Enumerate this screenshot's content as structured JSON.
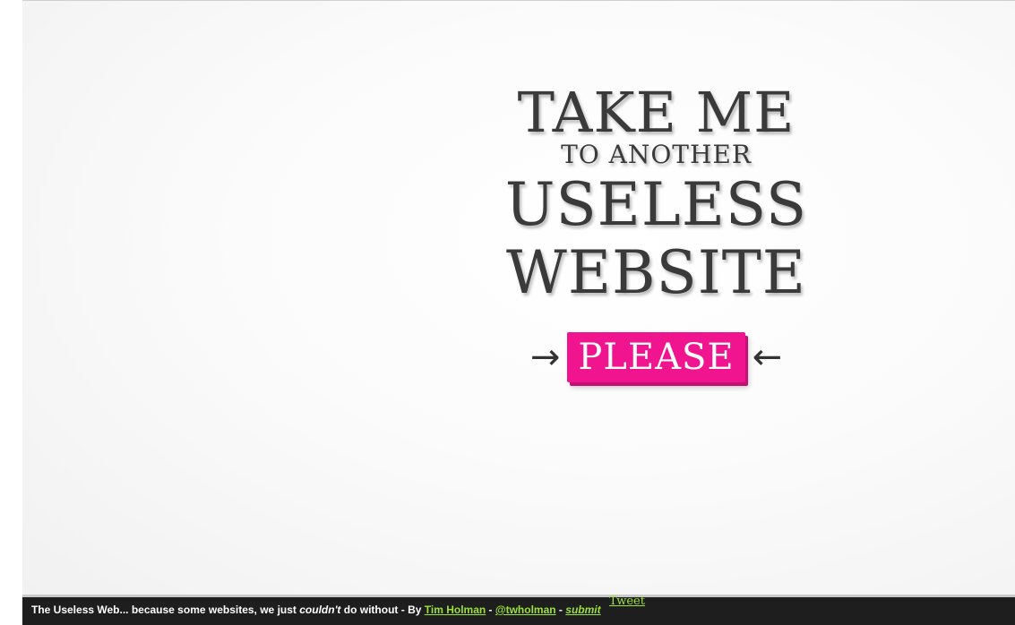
{
  "headline": {
    "line1": "TAKE ME",
    "line2": "TO ANOTHER",
    "line3": "USELESS",
    "line4": "WEBSITE"
  },
  "cta": {
    "left_arrow": "→",
    "label": "PLEASE",
    "right_arrow": "←",
    "color": "#f0148f"
  },
  "footer": {
    "text_before": "The Useless Web... because some websites, we just ",
    "emphasis": "couldn't",
    "text_after": " do without - By ",
    "author_link": "Tim Holman",
    "sep1": " - ",
    "handle_link": "@twholman",
    "sep2": " - ",
    "submit_link": "submit",
    "tweet_link": "Tweet",
    "link_color": "#9be03d"
  }
}
